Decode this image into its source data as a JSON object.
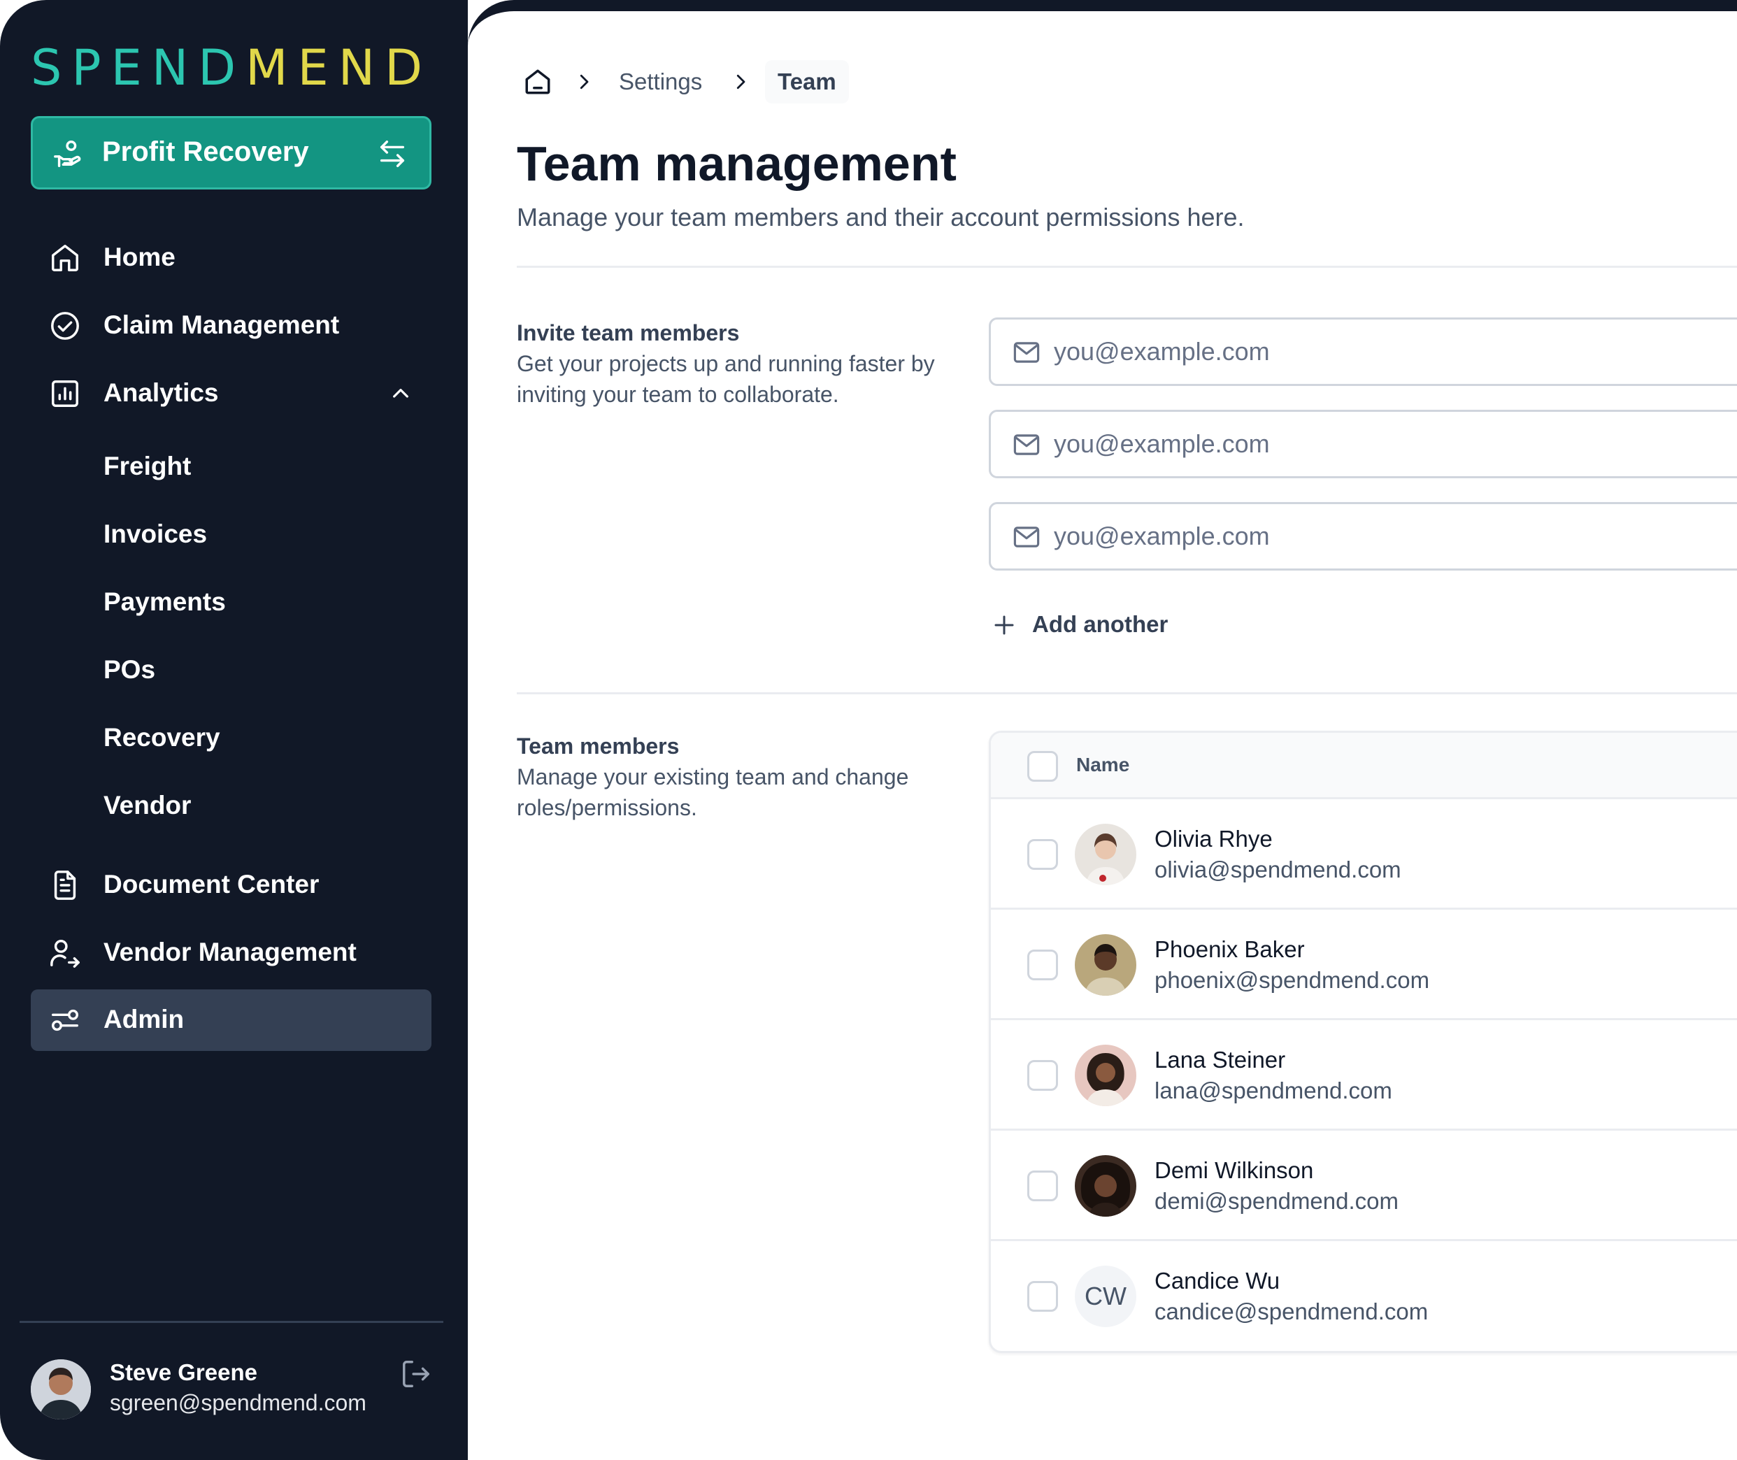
{
  "logo": {
    "part1": "SPEND",
    "part2": "MEND"
  },
  "workspace": {
    "label": "Profit Recovery"
  },
  "sidebar": {
    "items": [
      {
        "label": "Home"
      },
      {
        "label": "Claim Management"
      },
      {
        "label": "Analytics"
      },
      {
        "label": "Freight"
      },
      {
        "label": "Invoices"
      },
      {
        "label": "Payments"
      },
      {
        "label": "POs"
      },
      {
        "label": "Recovery"
      },
      {
        "label": "Vendor"
      },
      {
        "label": "Document Center"
      },
      {
        "label": "Vendor Management"
      },
      {
        "label": "Admin"
      }
    ]
  },
  "user": {
    "name": "Steve Greene",
    "email": "sgreen@spendmend.com"
  },
  "breadcrumb": {
    "settings": "Settings",
    "team": "Team"
  },
  "page": {
    "title": "Team management",
    "subtitle": "Manage your team members and their account permissions here."
  },
  "invite": {
    "title": "Invite team members",
    "description": "Get your projects up and running faster by inviting your team to collaborate.",
    "placeholder": "you@example.com",
    "add_label": "Add another"
  },
  "members": {
    "title": "Team members",
    "description": "Manage your existing team and change roles/permissions.",
    "column_name": "Name",
    "rows": [
      {
        "name": "Olivia Rhye",
        "email": "olivia@spendmend.com"
      },
      {
        "name": "Phoenix Baker",
        "email": "phoenix@spendmend.com"
      },
      {
        "name": "Lana Steiner",
        "email": "lana@spendmend.com"
      },
      {
        "name": "Demi Wilkinson",
        "email": "demi@spendmend.com"
      },
      {
        "name": "Candice Wu",
        "email": "candice@spendmend.com",
        "initials": "CW"
      }
    ]
  },
  "colors": {
    "sidebar_bg": "#111827",
    "accent_teal": "#139582",
    "logo_teal": "#2cc6b0",
    "logo_yellow": "#e1d84a",
    "active_item_bg": "#344054"
  }
}
